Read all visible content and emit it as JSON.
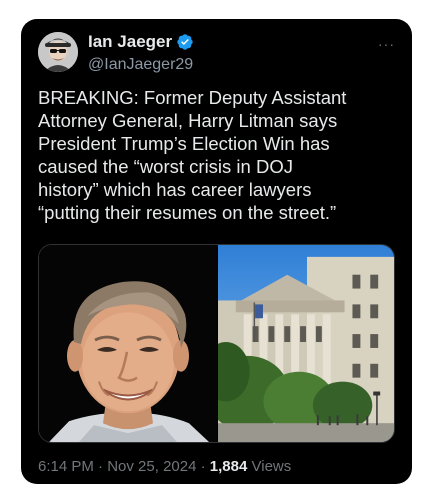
{
  "author": {
    "display_name": "Ian Jaeger",
    "handle": "@IanJaeger29",
    "verified_icon": "verified-badge-icon",
    "avatar_icon": "avatar-image"
  },
  "menu": {
    "more_label": "···"
  },
  "tweet": {
    "text": "BREAKING: Former Deputy Assistant\nAttorney General, Harry Litman says\nPresident Trump’s Election Win has\ncaused the “worst crisis in DOJ\nhistory” which has career lawyers\n“putting their resumes on the street.”"
  },
  "meta": {
    "time": "6:14 PM",
    "separator": "·",
    "date": "Nov 25, 2024",
    "views_count": "1,884",
    "views_label": "Views"
  },
  "colors": {
    "background": "#000000",
    "text": "#e7e9ea",
    "secondary": "#71767b",
    "verified": "#1d9bf0"
  }
}
